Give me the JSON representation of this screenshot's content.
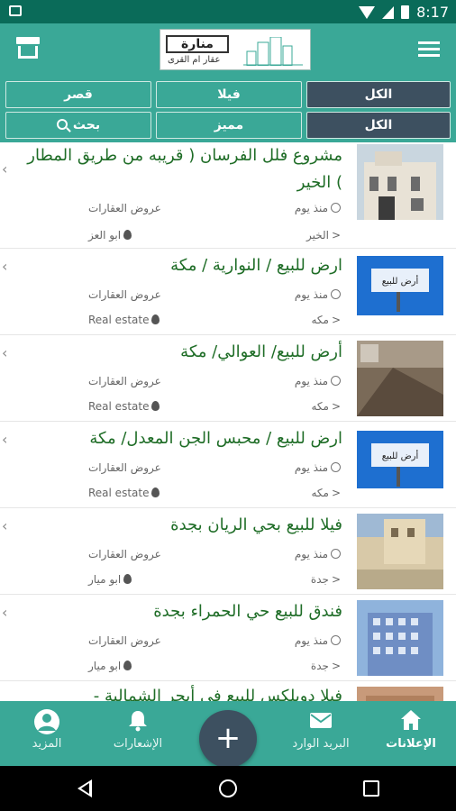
{
  "status": {
    "time": "8:17"
  },
  "header": {
    "logo_text": "منارة",
    "logo_subtext": "عقار ام القرى"
  },
  "filters": {
    "row1": [
      "الكل",
      "فيلا",
      "قصر"
    ],
    "row2": [
      "الكل",
      "مميز",
      "بحث"
    ]
  },
  "listings": [
    {
      "title": "مشروع فلل الفرسان ( قريبه من طريق المطار ) الخير",
      "time": "منذ يوم",
      "category": "عروض العقارات",
      "location": "الخير",
      "user": "ابو العز"
    },
    {
      "title": "ارض للبيع / النوارية / مكة",
      "time": "منذ يوم",
      "category": "عروض العقارات",
      "location": "مكه",
      "user": "Real estate"
    },
    {
      "title": "أرض للبيع/ العوالي/ مكة",
      "time": "منذ يوم",
      "category": "عروض العقارات",
      "location": "مكه",
      "user": "Real estate"
    },
    {
      "title": "ارض للبيع / محبس الجن المعدل/ مكة",
      "time": "منذ يوم",
      "category": "عروض العقارات",
      "location": "مكه",
      "user": "Real estate"
    },
    {
      "title": "فيلا للبيع بحي الريان بجدة",
      "time": "منذ يوم",
      "category": "عروض العقارات",
      "location": "جدة",
      "user": "ابو ميار"
    },
    {
      "title": "فندق للبيع حي الحمراء بجدة",
      "time": "منذ يوم",
      "category": "عروض العقارات",
      "location": "جدة",
      "user": "ابو ميار"
    },
    {
      "title": "فيلا دوبلكس للبيع في أبحر الشمالية -",
      "time": "",
      "category": "",
      "location": "",
      "user": ""
    }
  ],
  "thumb_sign_text": "أرض للبيع",
  "bottom_nav": {
    "ads": "الإعلانات",
    "inbox": "البريد الوارد",
    "add": "+",
    "notifications": "الإشعارات",
    "more": "المزيد"
  },
  "colors": {
    "primary": "#3aa897",
    "dark": "#3d5060",
    "title_green": "#1f6d27"
  }
}
